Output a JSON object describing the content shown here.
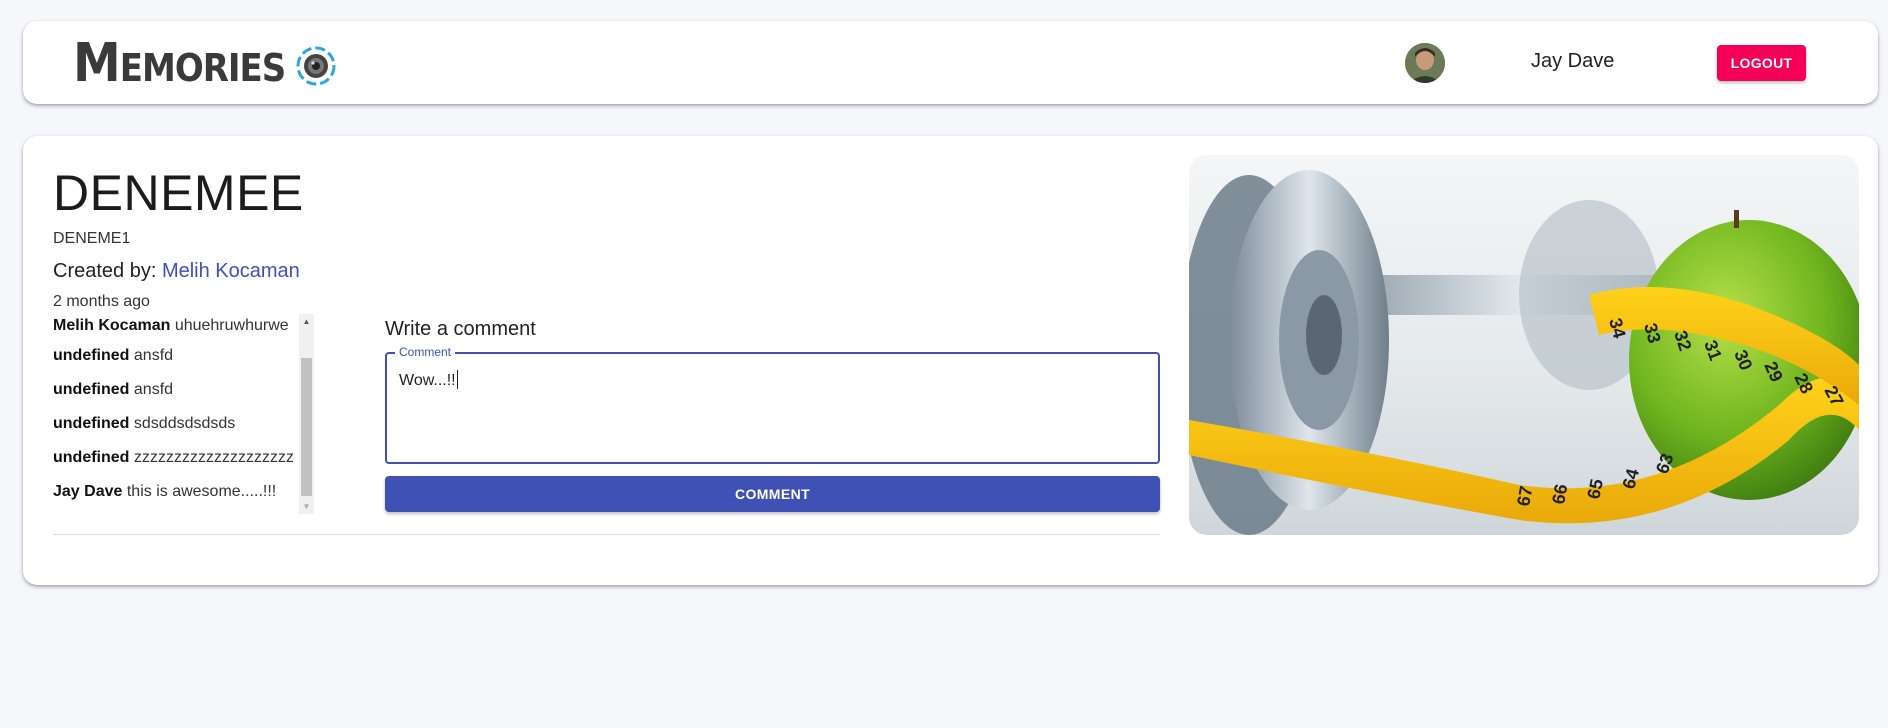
{
  "header": {
    "brand": "Memories",
    "user_name": "Jay Dave",
    "logout_label": "LOGOUT"
  },
  "post": {
    "title": "DENEMEE",
    "message": "DENEME1",
    "created_by_label": "Created by:",
    "creator": "Melih Kocaman",
    "time_ago": "2 months ago",
    "image_icon": "fitness-apple-measuring-tape"
  },
  "comments": [
    {
      "author": "Melih Kocaman",
      "text": "uhuehruwhurwe"
    },
    {
      "author": "undefined",
      "text": "ansfd"
    },
    {
      "author": "undefined",
      "text": "ansfd"
    },
    {
      "author": "undefined",
      "text": "sdsddsdsdsds"
    },
    {
      "author": "undefined",
      "text": "zzzzzzzzzzzzzzzzzzzzzzzzzz"
    },
    {
      "author": "Jay Dave",
      "text": "this is awesome.....!!!"
    }
  ],
  "comment_form": {
    "heading": "Write a comment",
    "field_label": "Comment",
    "value": "Wow...!!",
    "submit_label": "COMMENT"
  },
  "colors": {
    "primary": "#3f51b5",
    "secondary": "#f50057",
    "background": "#f5f7fb"
  }
}
